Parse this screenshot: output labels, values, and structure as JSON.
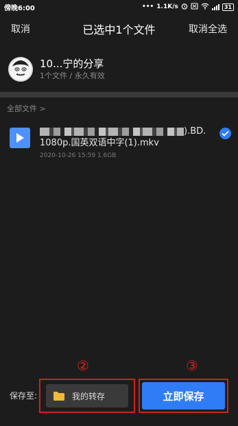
{
  "status_bar": {
    "time": "傍晚6:00",
    "network_speed": "1.1K/s",
    "battery": "31",
    "icons": [
      "notification-dots-icon",
      "alarm-icon",
      "sim-off-icon",
      "wifi-icon",
      "signal-icon",
      "battery-icon"
    ]
  },
  "header": {
    "cancel_label": "取消",
    "title": "已选中1个文件",
    "deselect_all_label": "取消全选"
  },
  "share": {
    "name": "10...宁的分享",
    "meta": "1个文件 / 永久有效"
  },
  "breadcrumb": "全部文件 >",
  "file": {
    "name_suffix": ").BD.",
    "name_line2": "1080p.国英双语中字(1).mkv",
    "meta": "2020-10-26 15:59  1.6GB",
    "selected": true,
    "icon": "video-file-icon"
  },
  "annotations": {
    "marker_2": "②",
    "marker_3": "③",
    "color": "#d02020"
  },
  "bottom": {
    "save_to_label": "保存至:",
    "folder_label": "我的转存",
    "save_now_label": "立即保存"
  },
  "colors": {
    "accent": "#2f7cf6",
    "background": "#1c1c1c",
    "folder": "#f0b93a"
  }
}
